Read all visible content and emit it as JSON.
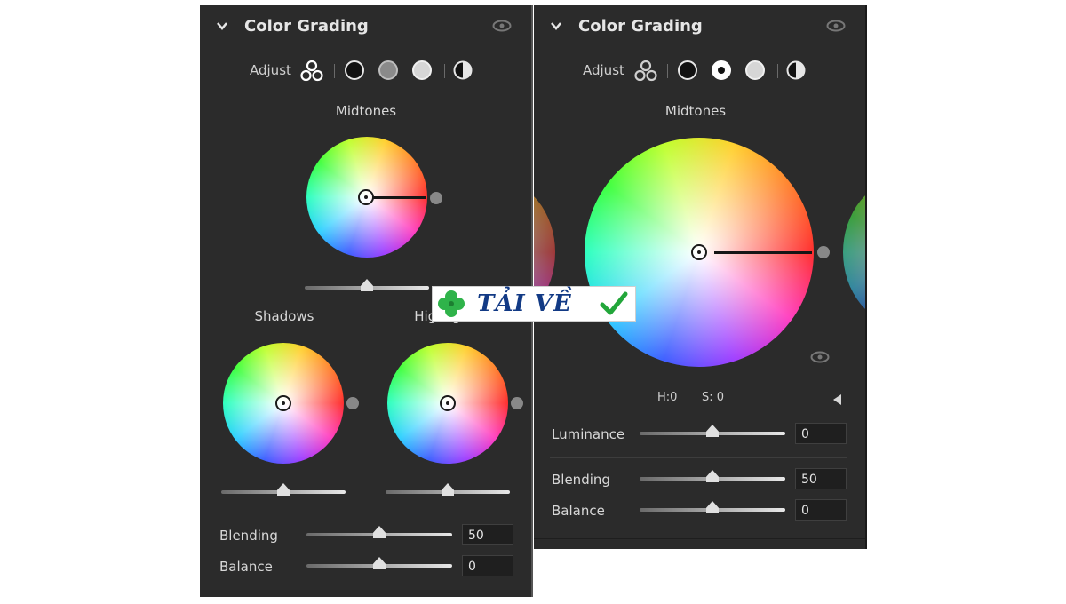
{
  "left_panel": {
    "title": "Color Grading",
    "adjust_label": "Adjust",
    "midtones_label": "Midtones",
    "shadows_label": "Shadows",
    "highlights_label": "Highlights",
    "blending_label": "Blending",
    "blending_value": "50",
    "balance_label": "Balance",
    "balance_value": "0",
    "selected_mode": "all-three"
  },
  "right_panel": {
    "title": "Color Grading",
    "adjust_label": "Adjust",
    "midtones_label": "Midtones",
    "hue_label": "H:",
    "hue_value": "0",
    "sat_label": "S:",
    "sat_value": "0",
    "luminance_label": "Luminance",
    "luminance_value": "0",
    "blending_label": "Blending",
    "blending_value": "50",
    "balance_label": "Balance",
    "balance_value": "0",
    "selected_mode": "midtones"
  },
  "watermark": {
    "text": "TẢI VỀ",
    "logo": "clover-icon",
    "check": "check-icon"
  },
  "colors": {
    "panel_bg": "#2b2b2b",
    "field_bg": "#1f1f1f",
    "watermark_text": "#123a85",
    "check": "#22a63a",
    "clover": "#2fb34a"
  }
}
